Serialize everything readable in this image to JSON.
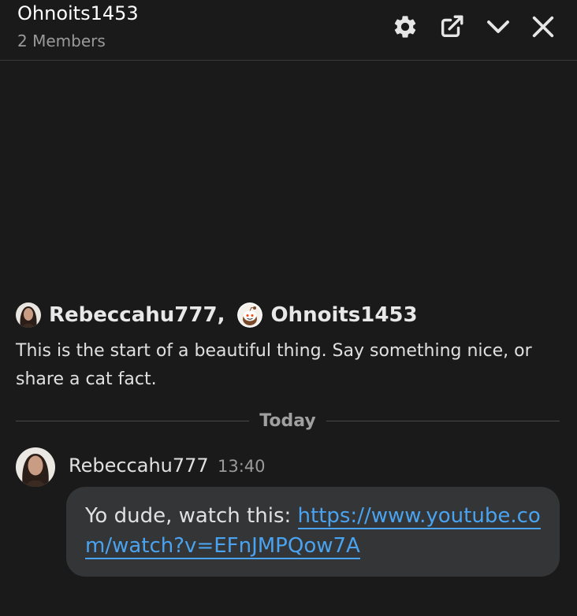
{
  "header": {
    "title": "Ohnoits1453",
    "members": "2 Members"
  },
  "icons": {
    "settings": "gear-icon",
    "popout": "external-link-icon",
    "minimize": "chevron-down-icon",
    "close": "close-icon"
  },
  "intro": {
    "user1": "Rebeccahu777",
    "separator": ",",
    "user2": "Ohnoits1453",
    "text": "This is the start of a beautiful thing. Say something nice, or share a cat fact."
  },
  "divider": {
    "label": "Today"
  },
  "message": {
    "author": "Rebeccahu777",
    "time": "13:40",
    "text": "Yo dude, watch this: ",
    "link": "https://www.youtube.com/watch?v=EFnJMPQow7A"
  },
  "colors": {
    "background": "#1a1a1b",
    "bubble": "#343536",
    "link": "#4aa3f0",
    "muted": "#9a9a9a"
  }
}
